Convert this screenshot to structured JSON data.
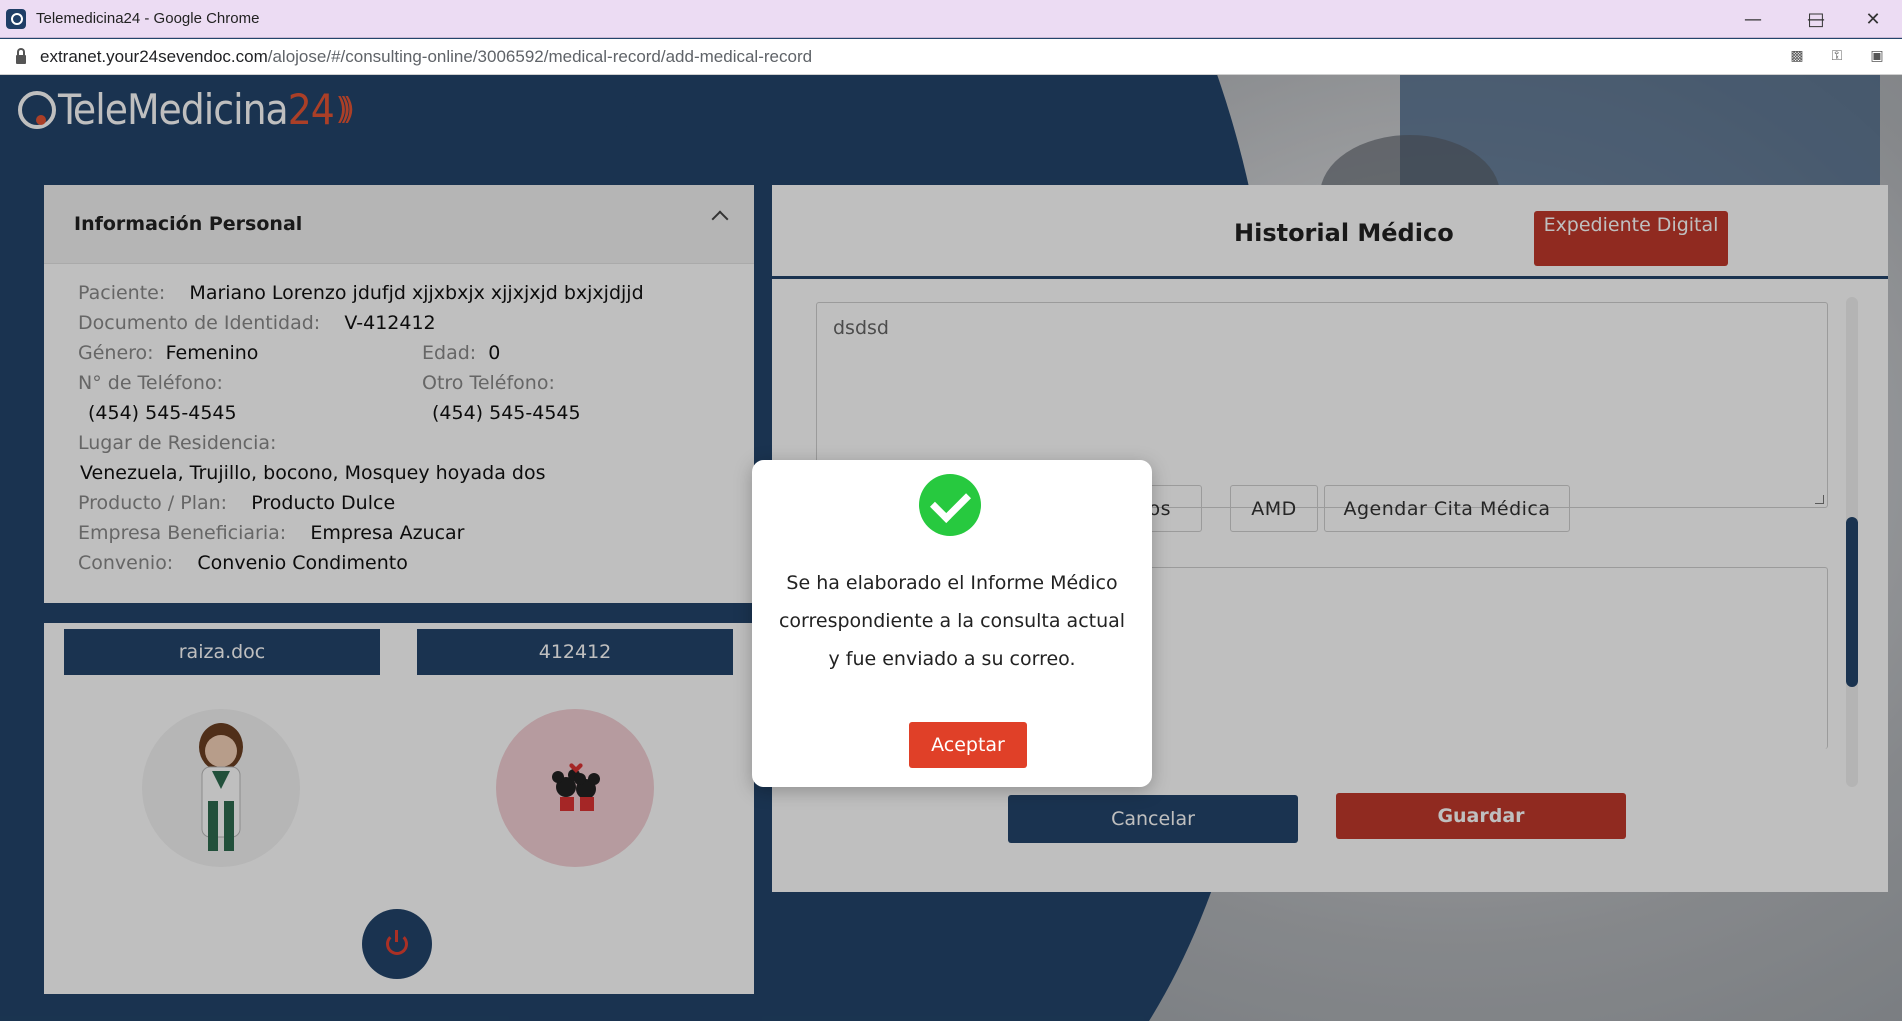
{
  "browser": {
    "window_title": "Telemedicina24 - Google Chrome",
    "url_host": "extranet.your24sevendoc.com",
    "url_path": "/alojose/#/consulting-online/3006592/medical-record/add-medical-record"
  },
  "logo": {
    "word": "TeleMedicina",
    "number": "24"
  },
  "personal_info": {
    "title": "Información Personal",
    "patient_label": "Paciente:",
    "patient": "Mariano Lorenzo jdufjd xjjxbxjx xjjxjxjd bxjxjdjjd",
    "id_label": "Documento de Identidad:",
    "id": "V-412412",
    "gender_label": "Género:",
    "gender": "Femenino",
    "age_label": "Edad:",
    "age": "0",
    "phone_label": "N° de Teléfono:",
    "phone": "(454) 545-4545",
    "other_phone_label": "Otro Teléfono:",
    "other_phone": "(454) 545-4545",
    "residence_label": "Lugar de Residencia:",
    "residence": "Venezuela, Trujillo, bocono, Mosquey hoyada dos",
    "plan_label": "Producto / Plan:",
    "plan": "Producto Dulce",
    "company_label": "Empresa Beneficiaria:",
    "company": "Empresa Azucar",
    "agreement_label": "Convenio:",
    "agreement": "Convenio Condimento"
  },
  "participants": {
    "doctor": "raiza.doc",
    "patient_code": "412412"
  },
  "history": {
    "title": "Historial Médico",
    "expediente_label": "Expediente Digital",
    "note_text": "dsdsd",
    "tab_partial": "nicos",
    "tab_amd": "AMD",
    "tab_agendar": "Agendar Cita Médica",
    "cancel_label": "Cancelar",
    "save_label": "Guardar"
  },
  "modal": {
    "message": "Se ha elaborado el Informe Médico correspondiente a la consulta actual y fue enviado a su correo.",
    "accept_label": "Aceptar"
  },
  "colors": {
    "navy": "#23456b",
    "red": "#c0392b",
    "success": "#27c93f"
  }
}
